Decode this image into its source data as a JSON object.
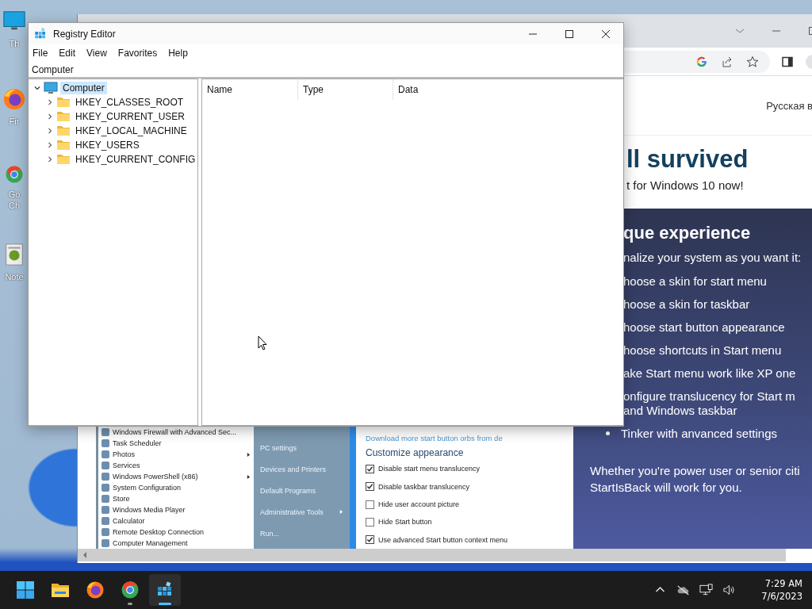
{
  "desktop": {
    "icons": [
      {
        "kind": "monitor",
        "lines": [
          "Th"
        ]
      },
      {
        "kind": "firefox",
        "lines": [
          "Fir"
        ]
      },
      {
        "kind": "chrome",
        "lines": [
          "Go",
          "Ch"
        ]
      },
      {
        "kind": "notepad",
        "lines": [
          "Note"
        ]
      }
    ]
  },
  "browser": {
    "header_link": "Русская в",
    "heading": "ll survived",
    "subheading": "t for Windows 10 now!",
    "screenshot": {
      "start_items": [
        {
          "label": "Windows Firewall with Advanced Sec...",
          "submenu": false
        },
        {
          "label": "Task Scheduler",
          "submenu": false
        },
        {
          "label": "Photos",
          "submenu": true
        },
        {
          "label": "Services",
          "submenu": false
        },
        {
          "label": "Windows PowerShell (x86)",
          "submenu": true
        },
        {
          "label": "System Configuration",
          "submenu": false
        },
        {
          "label": "Store",
          "submenu": false
        },
        {
          "label": "Windows Media Player",
          "submenu": false
        },
        {
          "label": "Calculator",
          "submenu": false
        },
        {
          "label": "Remote Desktop Connection",
          "submenu": false
        },
        {
          "label": "Computer Management",
          "submenu": false
        }
      ],
      "places": [
        {
          "label": "PC settings",
          "submenu": false
        },
        {
          "label": "Devices and Printers",
          "submenu": false
        },
        {
          "label": "Default Programs",
          "submenu": false
        },
        {
          "label": "Administrative Tools",
          "submenu": true
        },
        {
          "label": "Run...",
          "submenu": false
        }
      ],
      "link": "Download more start button orbs from de",
      "section_title": "Customize appearance",
      "options": [
        {
          "label": "Disable start menu translucency",
          "checked": true
        },
        {
          "label": "Disable taskbar translucency",
          "checked": true
        },
        {
          "label": "Hide user account picture",
          "checked": false
        },
        {
          "label": "Hide Start button",
          "checked": false
        },
        {
          "label": "Use advanced Start button context menu",
          "checked": true
        }
      ]
    },
    "features": {
      "heading": "que experience",
      "intro": "nalize your system as you want it:",
      "cut_items": [
        "hoose a skin for start menu",
        "hoose a skin for taskbar",
        "hoose start button appearance",
        "hoose shortcuts in Start menu",
        "ake Start menu work like XP one",
        "onfigure translucency for Start m\nand Windows taskbar"
      ],
      "bullets": [
        "Tinker with anvanced settings"
      ],
      "closing": "Whether you're power user or senior citi\nStartIsBack will work for you."
    }
  },
  "registry": {
    "title": "Registry Editor",
    "menu": [
      "File",
      "Edit",
      "View",
      "Favorites",
      "Help"
    ],
    "address": "Computer",
    "tree": [
      {
        "label": "Computer",
        "kind": "computer",
        "expanded": true,
        "selected": true,
        "children": [
          {
            "label": "HKEY_CLASSES_ROOT",
            "kind": "folder",
            "expanded": false,
            "selected": false
          },
          {
            "label": "HKEY_CURRENT_USER",
            "kind": "folder",
            "expanded": false,
            "selected": false
          },
          {
            "label": "HKEY_LOCAL_MACHINE",
            "kind": "folder",
            "expanded": false,
            "selected": false
          },
          {
            "label": "HKEY_USERS",
            "kind": "folder",
            "expanded": false,
            "selected": false
          },
          {
            "label": "HKEY_CURRENT_CONFIG",
            "kind": "folder",
            "expanded": false,
            "selected": false
          }
        ]
      }
    ],
    "columns": [
      "Name",
      "Type",
      "Data"
    ]
  },
  "taskbar": {
    "apps": [
      {
        "kind": "start",
        "running": false,
        "selected": false
      },
      {
        "kind": "explorer",
        "running": false,
        "selected": false
      },
      {
        "kind": "firefox",
        "running": false,
        "selected": false
      },
      {
        "kind": "chrome",
        "running": true,
        "selected": false
      },
      {
        "kind": "regedit",
        "running": true,
        "selected": true
      }
    ],
    "time": "7:29 AM",
    "date": "7/6/2023"
  }
}
